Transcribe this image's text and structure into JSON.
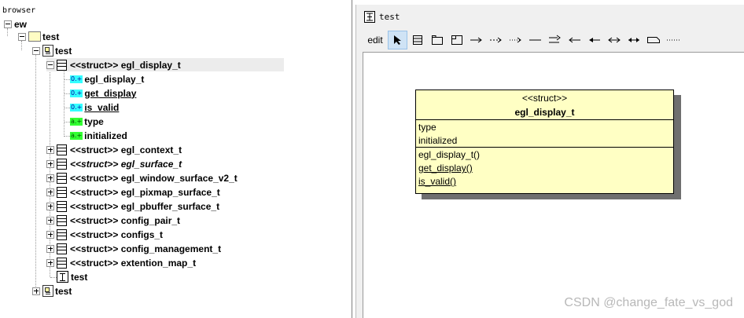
{
  "browser": {
    "title": "browser",
    "root": "ew",
    "package": "test",
    "class_view": "test",
    "selected_struct": "<<struct>> egl_display_t",
    "members": [
      {
        "badge": "0.+",
        "badge_color": "#33ffff",
        "label": "egl_display_t",
        "underline": false
      },
      {
        "badge": "0.+",
        "badge_color": "#33ffff",
        "label": "get_display",
        "underline": true
      },
      {
        "badge": "0.+",
        "badge_color": "#33ffff",
        "label": "is_valid",
        "underline": true
      },
      {
        "badge": "a.+",
        "badge_color": "#33ff33",
        "label": "type",
        "underline": false
      },
      {
        "badge": "a.+",
        "badge_color": "#33ff33",
        "label": "initialized",
        "underline": false
      }
    ],
    "structs": [
      {
        "label": "<<struct>> egl_context_t",
        "italic": false
      },
      {
        "label": "<<struct>> egl_surface_t",
        "italic": true
      },
      {
        "label": "<<struct>> egl_window_surface_v2_t",
        "italic": false
      },
      {
        "label": "<<struct>> egl_pixmap_surface_t",
        "italic": false
      },
      {
        "label": "<<struct>> egl_pbuffer_surface_t",
        "italic": false
      },
      {
        "label": "<<struct>> config_pair_t",
        "italic": false
      },
      {
        "label": "<<struct>> configs_t",
        "italic": false
      },
      {
        "label": "<<struct>> config_management_t",
        "italic": false
      },
      {
        "label": "<<struct>> extention_map_t",
        "italic": false
      }
    ],
    "diagram_item": "test",
    "deployment_item": "test"
  },
  "diagram_window": {
    "title": "test",
    "toolbar": {
      "edit_label": "edit",
      "tools": [
        "select-arrow-icon",
        "class-icon",
        "package-icon",
        "note-icon",
        "generalisation-arrow-icon",
        "dependency-arrow-icon",
        "realization-arrow-icon",
        "line-icon",
        "inherit-arrow-icon",
        "association-left-icon",
        "composition-icon",
        "bidirectional-arrow-icon",
        "aggregation-icon",
        "note-shape-icon",
        "dotted-line-icon"
      ]
    }
  },
  "uml_class": {
    "stereotype": "<<struct>>",
    "name": "egl_display_t",
    "attributes": [
      "type",
      "initialized"
    ],
    "operations": [
      "egl_display_t()",
      "get_display()",
      "is_valid()"
    ],
    "underlined_operations": [
      false,
      true,
      true
    ]
  },
  "watermark": "CSDN @change_fate_vs_god",
  "colors": {
    "class_fill": "#ffffc4",
    "public_badge": "#33ffff",
    "attribute_badge": "#33ff33",
    "toolbar_selected": "#cfe3f5"
  }
}
